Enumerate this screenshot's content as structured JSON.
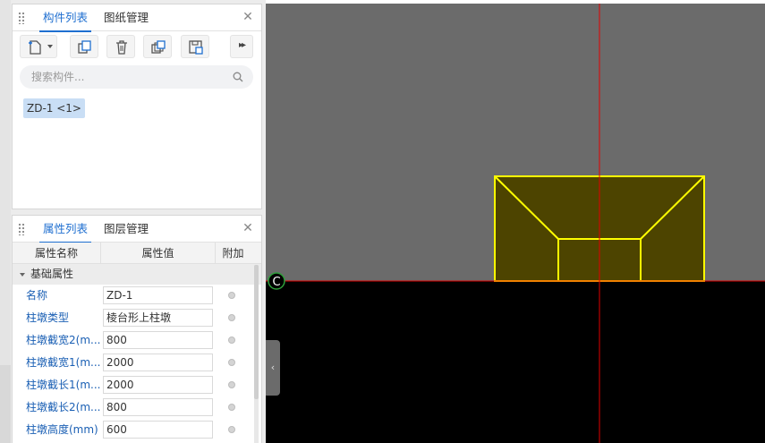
{
  "component_panel": {
    "tabs": [
      {
        "label": "构件列表",
        "active": true
      },
      {
        "label": "图纸管理",
        "active": false
      }
    ],
    "search_placeholder": "搜索构件...",
    "items": [
      {
        "label": "ZD-1 <1>",
        "selected": true
      }
    ]
  },
  "property_panel": {
    "tabs": [
      {
        "label": "属性列表",
        "active": true
      },
      {
        "label": "图层管理",
        "active": false
      }
    ],
    "columns": [
      "属性名称",
      "属性值",
      "附加"
    ],
    "group": "基础属性",
    "rows": [
      {
        "name": "名称",
        "value": "ZD-1"
      },
      {
        "name": "柱墩类型",
        "value": "棱台形上柱墩"
      },
      {
        "name": "柱墩截宽2(m...",
        "value": "800"
      },
      {
        "name": "柱墩截宽1(m...",
        "value": "2000"
      },
      {
        "name": "柱墩截长1(m...",
        "value": "2000"
      },
      {
        "name": "柱墩截长2(m...",
        "value": "800"
      },
      {
        "name": "柱墩高度(mm)",
        "value": "600"
      }
    ]
  },
  "canvas": {
    "marker_label": "C",
    "background_upper": "#6b6b6b",
    "background_lower": "#000000",
    "shape_color": "#ffff00",
    "shape_fill": "#4d4400",
    "axis_color": "#e00000"
  },
  "colors": {
    "accent": "#1f6fd0",
    "property_name": "#1a5fb4",
    "selection": "#c9def5"
  }
}
